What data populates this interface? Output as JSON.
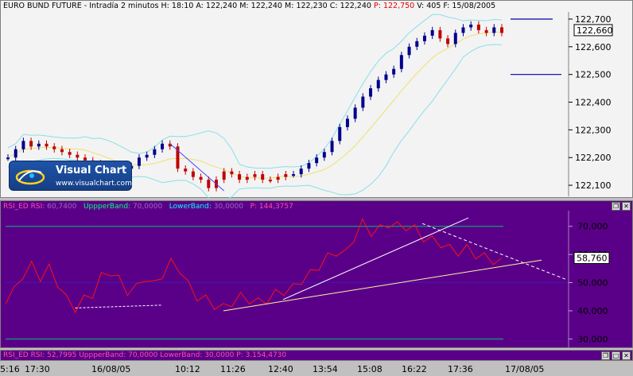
{
  "header": {
    "instrument": "EURO BUND FUTURE - Intradía 2 minutos",
    "h_label": "H:",
    "h_value": "18:10",
    "a_label": "A:",
    "a_value": "122,240",
    "m_label": "M:",
    "m_value": "122,240",
    "mn_label": "M:",
    "mn_value": "122,230",
    "c_label": "C:",
    "c_value": "122,240",
    "p_label": "P:",
    "p_value": "122,750",
    "v_label": "V:",
    "v_value": "405",
    "f_label": "F:",
    "f_value": "15/08/2005"
  },
  "logo": {
    "name": "Visual Chart",
    "url": "www.visualchart.com"
  },
  "rsi_header": {
    "rsi_label": "RSI_ED",
    "rsi_sub": "RSI:",
    "rsi_value": "60,7400",
    "upper_label": "UppperBand:",
    "upper_value": "70,0000",
    "lower_label": "LowerBand:",
    "lower_value": "30,0000",
    "p_label": "P:",
    "p_value": "144,3757"
  },
  "status_strip": {
    "text": "RSI_ED  RSI: 52,7995  UppperBand: 70,0000  LowerBand: 30,0000  P: 3.154,4730"
  },
  "colors": {
    "top_bg": "#f3f3f3",
    "rsi_bg": "#5a0088",
    "candle_blue": "#00008b",
    "candle_red": "#c00000",
    "bollinger": "#87e0e8",
    "moving_avg": "#f0e070",
    "rsi_line": "#ff1010",
    "band_line": "#00c070",
    "trendline": "#ffffff"
  },
  "chart_data": [
    {
      "type": "candlestick",
      "title": "EURO BUND FUTURE - Intradía 2 minutos",
      "y_ticks": [
        "122,700",
        "122,600",
        "122,500",
        "122,400",
        "122,300",
        "122,200",
        "122,100"
      ],
      "ylim": [
        122.06,
        122.72
      ],
      "last_price_label": "122,660",
      "last_price": 122.66,
      "reference_levels": [
        122.7,
        122.5
      ],
      "close_series": [
        122.2,
        122.23,
        122.26,
        122.24,
        122.25,
        122.24,
        122.23,
        122.22,
        122.21,
        122.2,
        122.19,
        122.18,
        122.16,
        122.15,
        122.15,
        122.16,
        122.17,
        122.2,
        122.21,
        122.23,
        122.25,
        122.24,
        122.16,
        122.15,
        122.13,
        122.12,
        122.09,
        122.12,
        122.15,
        122.14,
        122.12,
        122.13,
        122.14,
        122.12,
        122.12,
        122.13,
        122.14,
        122.14,
        122.16,
        122.18,
        122.2,
        122.22,
        122.26,
        122.31,
        122.34,
        122.38,
        122.42,
        122.45,
        122.48,
        122.5,
        122.52,
        122.57,
        122.6,
        122.62,
        122.64,
        122.66,
        122.63,
        122.61,
        122.65,
        122.67,
        122.68,
        122.66,
        122.65,
        122.67,
        122.65
      ],
      "gap_after_index": 37
    },
    {
      "type": "line",
      "title": "RSI_ED",
      "y_ticks": [
        "70,000",
        "60,000",
        "50,000",
        "40,000",
        "30,000"
      ],
      "ylim": [
        27,
        75
      ],
      "last_value_label": "58,760",
      "last_value": 58.76,
      "upper_band": 70,
      "lower_band": 30,
      "x_ticks": [
        "5:16",
        "17:30",
        "16/08/05",
        "10:12",
        "11:26",
        "12:40",
        "13:54",
        "15:08",
        "16:22",
        "17:36",
        "17/08/05"
      ],
      "values": [
        44,
        47,
        53,
        56,
        52,
        55,
        50,
        44,
        41,
        44,
        46,
        52,
        54,
        51,
        47,
        48,
        52,
        49,
        53,
        57,
        55,
        49,
        45,
        44,
        42,
        41,
        43,
        45,
        44,
        43,
        44,
        46,
        47,
        48,
        51,
        53,
        56,
        59,
        61,
        60,
        66,
        71,
        68,
        69,
        71,
        70,
        70,
        69,
        66,
        65,
        64,
        62,
        61,
        62,
        60,
        59,
        58,
        58.76
      ]
    }
  ]
}
